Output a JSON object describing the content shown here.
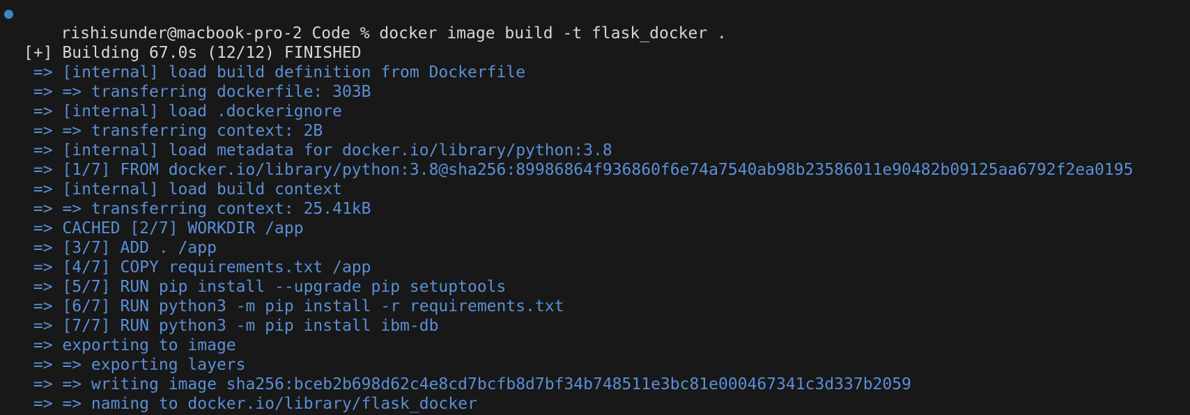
{
  "terminal": {
    "prompt": {
      "user_host": "rishisunder@macbook-pro-2",
      "cwd": "Code",
      "symbol": "%",
      "command": "docker image build -t flask_docker ."
    },
    "status": "[+] Building 67.0s (12/12) FINISHED",
    "colors": {
      "background": "#181818",
      "text": "#d7d7d7",
      "step": "#5b8fd6",
      "prompt_dot": "#3d87c4"
    },
    "steps": [
      " => [internal] load build definition from Dockerfile",
      " => => transferring dockerfile: 303B",
      " => [internal] load .dockerignore",
      " => => transferring context: 2B",
      " => [internal] load metadata for docker.io/library/python:3.8",
      " => [1/7] FROM docker.io/library/python:3.8@sha256:89986864f936860f6e74a7540ab98b23586011e90482b09125aa6792f2ea0195",
      " => [internal] load build context",
      " => => transferring context: 25.41kB",
      " => CACHED [2/7] WORKDIR /app",
      " => [3/7] ADD . /app",
      " => [4/7] COPY requirements.txt /app",
      " => [5/7] RUN pip install --upgrade pip setuptools",
      " => [6/7] RUN python3 -m pip install -r requirements.txt",
      " => [7/7] RUN python3 -m pip install ibm-db",
      " => exporting to image",
      " => => exporting layers",
      " => => writing image sha256:bceb2b698d62c4e8cd7bcfb8d7bf34b748511e3bc81e000467341c3d337b2059",
      " => => naming to docker.io/library/flask_docker"
    ]
  }
}
